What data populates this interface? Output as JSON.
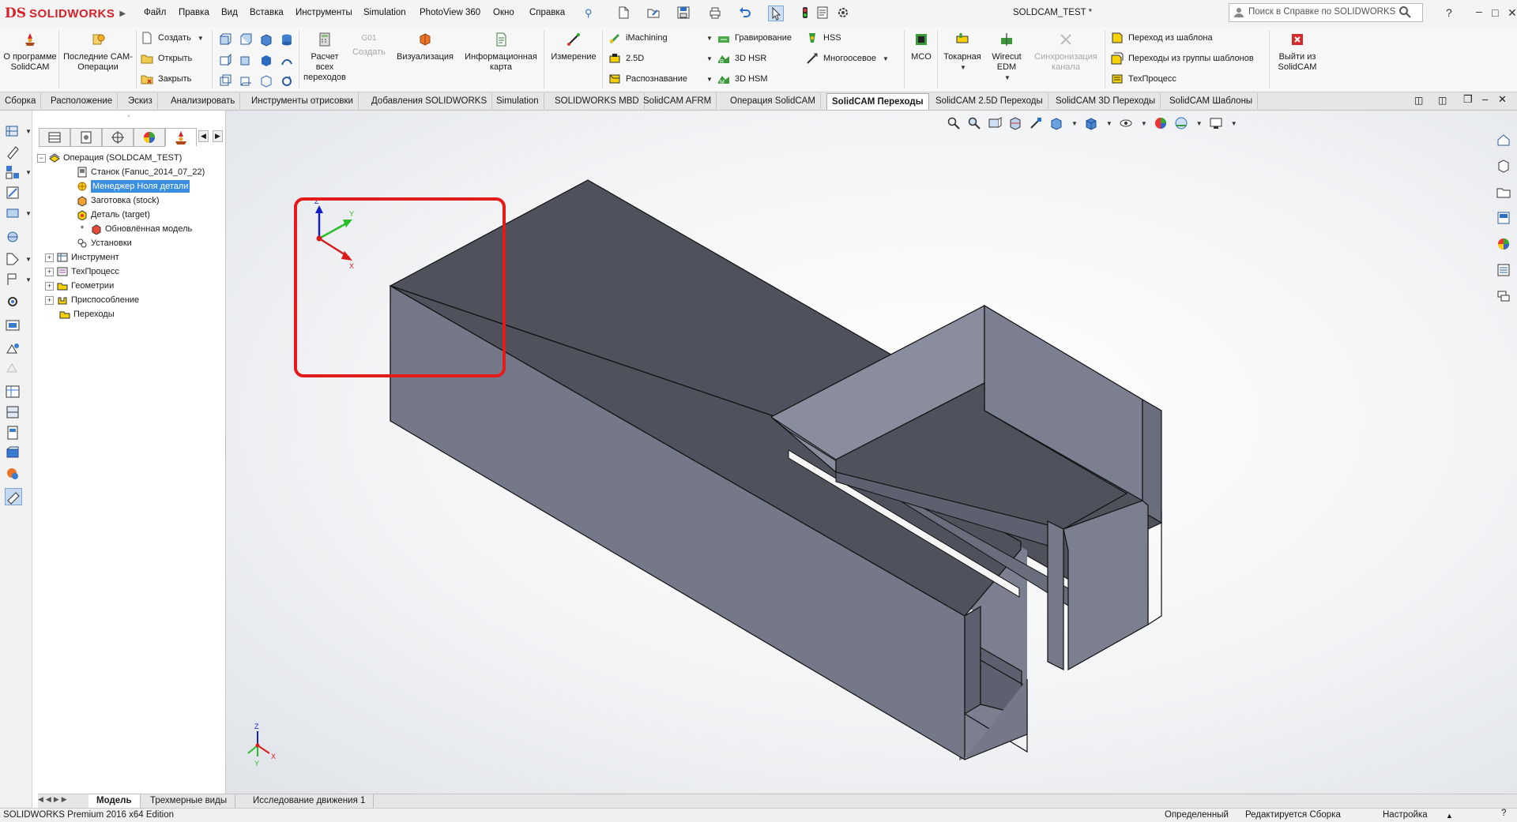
{
  "app": {
    "logo_ds": "DS",
    "logo_text": "SOLIDWORKS",
    "doc_title": "SOLDCAM_TEST *"
  },
  "menu": [
    "Файл",
    "Правка",
    "Вид",
    "Вставка",
    "Инструменты",
    "Simulation",
    "PhotoView 360",
    "Окно",
    "Справка"
  ],
  "search": {
    "placeholder": "Поиск в Справке по SOLIDWORKS"
  },
  "ribbon": {
    "about": "О программе SolidCAM",
    "recent_ops": "Последние CAM-Операции",
    "create": "Создать",
    "open": "Открыть",
    "close": "Закрыть",
    "calc_all": "Расчет всех переходов",
    "g01_label": "G01",
    "g01_create": "Создать",
    "visualization": "Визуализация",
    "info_card": "Информационная карта",
    "measure": "Измерение",
    "imachining": "iMachining",
    "d25": "2.5D",
    "recognition": "Распознавание",
    "engraving": "Гравирование",
    "hsr": "3D HSR",
    "hsm": "3D HSM",
    "hss": "HSS",
    "multiaxis": "Многоосевое",
    "mco": "MCO",
    "turning": "Токарная",
    "wirecut": "Wirecut EDM",
    "sync": "Синхронизация канала",
    "from_template": "Переход из шаблона",
    "from_group": "Переходы из группы шаблонов",
    "techprocess": "ТехПроцесс",
    "exit": "Выйти из SolidCAM"
  },
  "tabs": [
    "Сборка",
    "Расположение",
    "Эскиз",
    "Анализировать",
    "Инструменты отрисовки",
    "Добавления SOLIDWORKS",
    "Simulation",
    "SOLIDWORKS MBD",
    "SolidCAM AFRM",
    "Операция SolidCAM",
    "SolidCAM Переходы",
    "SolidCAM 2.5D Переходы",
    "SolidCAM 3D Переходы",
    "SolidCAM Шаблоны"
  ],
  "tree": {
    "root": "Операция (SOLDCAM_TEST)",
    "machine": "Станок (Fanuc_2014_07_22)",
    "zero_manager": "Менеджер Ноля детали",
    "stock": "Заготовка (stock)",
    "target": "Деталь (target)",
    "updated_model": "Обновлённая модель",
    "setups": "Установки",
    "tool": "Инструмент",
    "techprocess": "ТехПроцесс",
    "geometries": "Геометрии",
    "fixture": "Приспособление",
    "operations": "Переходы"
  },
  "axes": {
    "x": "X",
    "y": "Y",
    "z": "Z"
  },
  "bottom_tabs": [
    "Модель",
    "Трехмерные виды",
    "Исследование движения 1"
  ],
  "status": {
    "edition": "SOLIDWORKS Premium 2016 x64 Edition",
    "defined": "Определенный",
    "editing": "Редактируется Сборка",
    "settings": "Настройка"
  },
  "colors": {
    "accent": "#d2232a",
    "selection": "#3b8fe2",
    "highlight_box": "#e41b1b",
    "part_top": "#4f515d",
    "part_side": "#747889"
  }
}
